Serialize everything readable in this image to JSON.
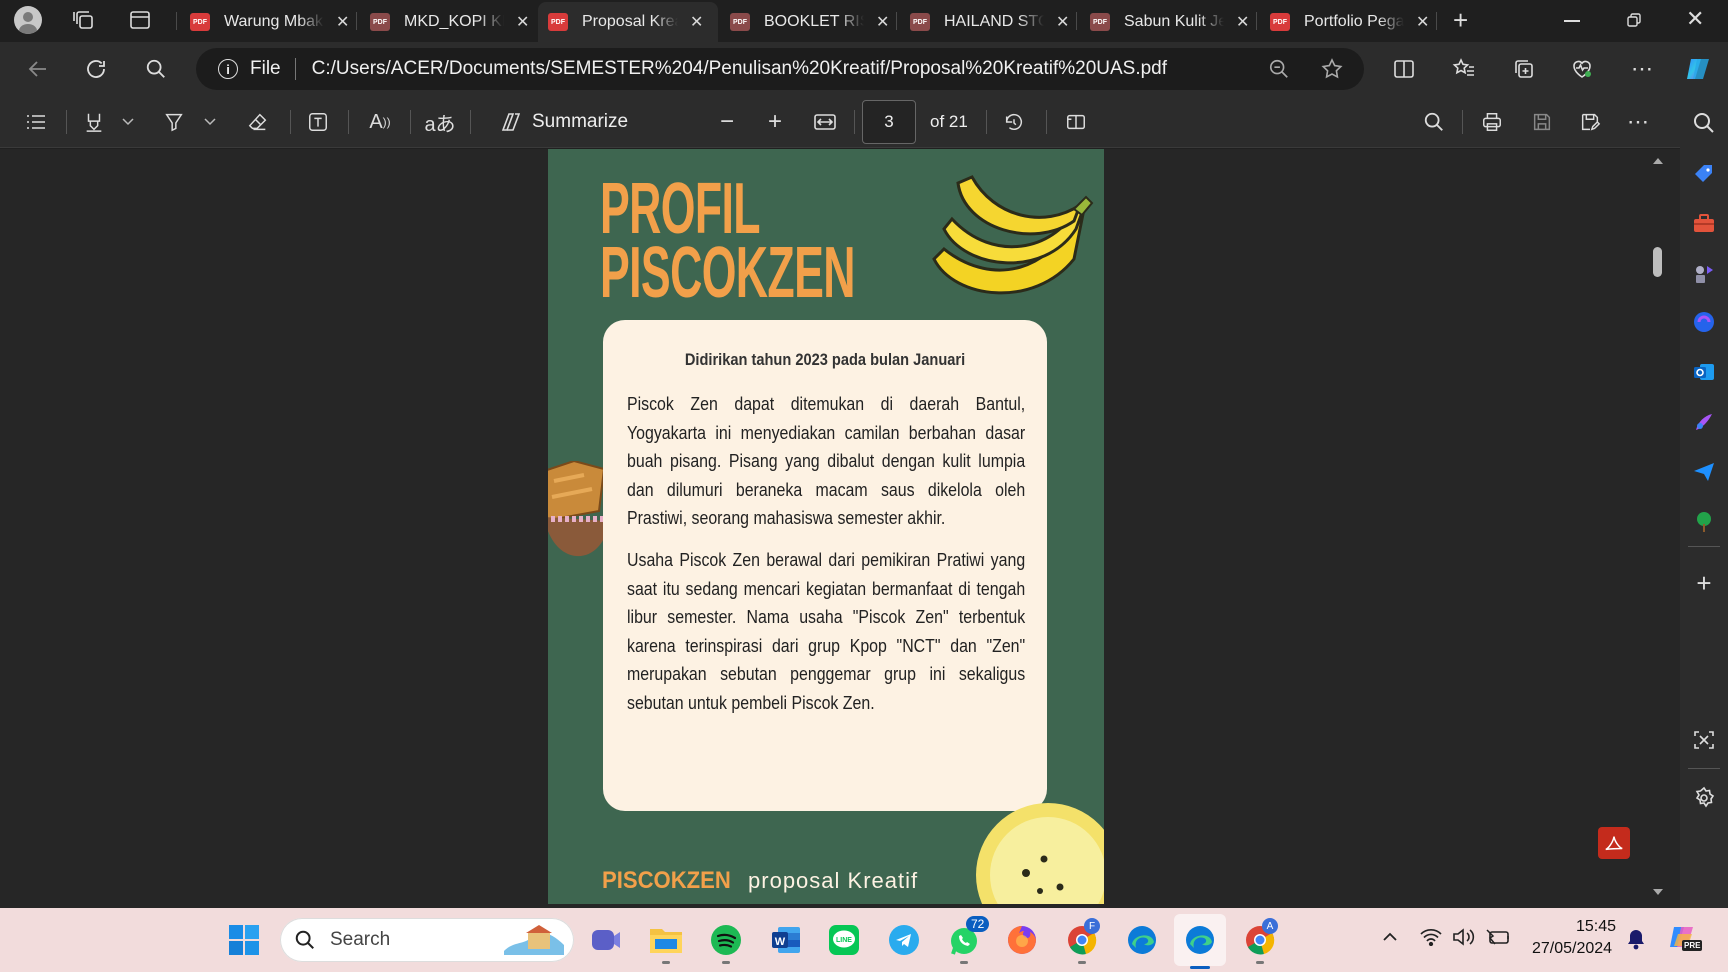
{
  "tabs": [
    {
      "title": "Warung Mbak",
      "active": false
    },
    {
      "title": "MKD_KOPI KE",
      "active": false
    },
    {
      "title": "Proposal Kreatif",
      "active": true
    },
    {
      "title": "BOOKLET RISET",
      "active": false
    },
    {
      "title": "HAILAND STORE",
      "active": false
    },
    {
      "title": "Sabun Kulit Jeruk",
      "active": false
    },
    {
      "title": "Portfolio Pegawai",
      "active": false
    }
  ],
  "address": {
    "scheme_label": "File",
    "url": "C:/Users/ACER/Documents/SEMESTER%204/Penulisan%20Kreatif/Proposal%20Kreatif%20UAS.pdf"
  },
  "pdf_toolbar": {
    "summarize_label": "Summarize",
    "page_current": "3",
    "page_total": "of 21",
    "pdf_badge": "PDF"
  },
  "document": {
    "heading_line1": "PROFIL",
    "heading_line2": "PISCOKZEN",
    "subtitle": "Didirikan tahun 2023 pada bulan Januari",
    "paragraph1": "Piscok Zen dapat ditemukan di daerah Bantul, Yogyakarta ini menyediakan camilan berbahan dasar buah pisang. Pisang yang dibalut dengan kulit lumpia dan dilumuri beraneka macam saus dikelola oleh Prastiwi, seorang mahasiswa semester akhir.",
    "paragraph2": "Usaha Piscok Zen berawal dari pemikiran Pratiwi yang saat itu sedang mencari kegiatan bermanfaat di tengah libur semester. Nama usaha \"Piscok Zen\" terbentuk karena terinspirasi dari grup Kpop \"NCT\" dan \"Zen\" merupakan sebutan penggemar grup ini sekaligus sebutan untuk pembeli Piscok Zen.",
    "footer_brand": "PISCOKZEN",
    "footer_sub": "proposal Kreatif"
  },
  "taskbar": {
    "search_placeholder": "Search",
    "whatsapp_badge": "72",
    "chrome_badge_1": "F",
    "chrome_badge_2": "A",
    "time": "15:45",
    "date": "27/05/2024",
    "copilot_badge": "PRE"
  },
  "colors": {
    "page_green": "#3e6650",
    "accent_orange": "#f2a04a",
    "card_cream": "#fdf2e3",
    "taskbar_pink": "#f2dcdc"
  }
}
